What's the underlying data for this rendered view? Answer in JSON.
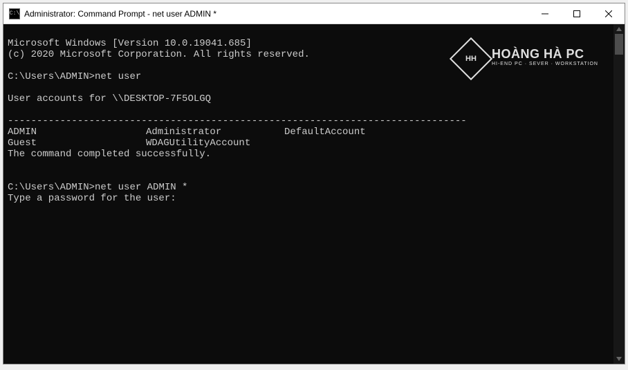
{
  "window": {
    "icon_label": "C:\\",
    "title": "Administrator: Command Prompt - net  user ADMIN *"
  },
  "terminal": {
    "line_version": "Microsoft Windows [Version 10.0.19041.685]",
    "line_copyright": "(c) 2020 Microsoft Corporation. All rights reserved.",
    "prompt1_path": "C:\\Users\\ADMIN>",
    "prompt1_cmd": "net user",
    "accounts_header": "User accounts for \\\\DESKTOP-7F5OLGQ",
    "separator": "-------------------------------------------------------------------------------",
    "row1_c1": "ADMIN",
    "row1_c2": "Administrator",
    "row1_c3": "DefaultAccount",
    "row2_c1": "Guest",
    "row2_c2": "WDAGUtilityAccount",
    "row2_c3": "",
    "completed": "The command completed successfully.",
    "prompt2_path": "C:\\Users\\ADMIN>",
    "prompt2_cmd": "net user ADMIN *",
    "password_prompt": "Type a password for the user:"
  },
  "watermark": {
    "logo_initials": "HH",
    "brand": "HOÀNG HÀ PC",
    "tagline": "HI-END PC · SEVER · WORKSTATION"
  }
}
